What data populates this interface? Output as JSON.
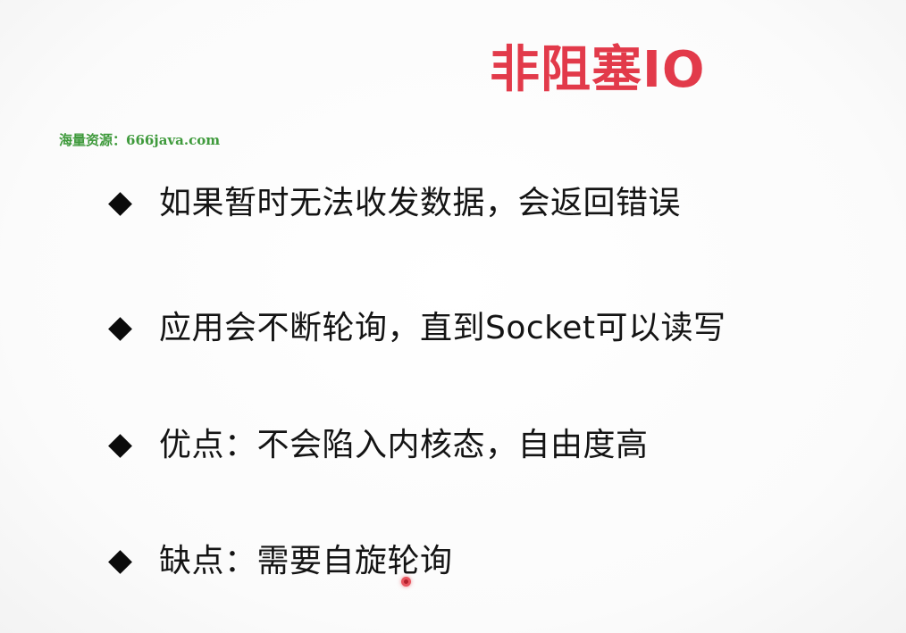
{
  "slide": {
    "title": "非阻塞IO",
    "watermark": "海量资源：666java.com",
    "bullets": [
      "如果暂时无法收发数据，会返回错误",
      "应用会不断轮询，直到Socket可以读写",
      "优点：不会陷入内核态，自由度高",
      "缺点：需要自旋轮询"
    ]
  },
  "colors": {
    "title": "#e23a4a",
    "watermark": "#3f9a3c",
    "text": "#141414",
    "pointer": "#e8555f"
  },
  "icons": {
    "bullet": "diamond-icon",
    "pointer": "laser-pointer-icon"
  }
}
